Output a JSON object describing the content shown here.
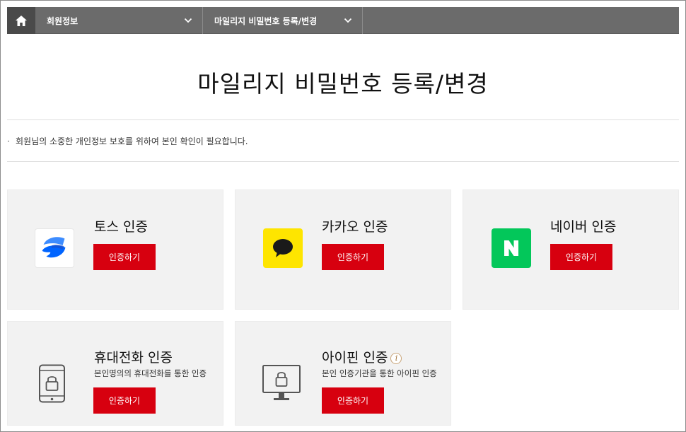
{
  "nav": {
    "home_icon": "home-icon",
    "segments": [
      {
        "label": "회원정보"
      },
      {
        "label": "마일리지 비밀번호 등록/변경"
      }
    ]
  },
  "page": {
    "title": "마일리지 비밀번호 등록/변경",
    "notice": "회원님의 소중한 개인정보 보호를 위하여 본인 확인이 필요합니다.",
    "notice_bullet": "·"
  },
  "colors": {
    "nav_bg": "#6b6b6b",
    "home_bg": "#4a4a4a",
    "card_bg": "#f2f2f2",
    "button_red": "#d7000f",
    "kakao_yellow": "#fee500",
    "naver_green": "#03c75a",
    "toss_blue": "#0064ff"
  },
  "cards": [
    {
      "title": "토스 인증",
      "subtitle": "",
      "button": "인증하기",
      "icon": "toss-logo-icon"
    },
    {
      "title": "카카오 인증",
      "subtitle": "",
      "button": "인증하기",
      "icon": "kakao-logo-icon"
    },
    {
      "title": "네이버 인증",
      "subtitle": "",
      "button": "인증하기",
      "icon": "naver-logo-icon"
    },
    {
      "title": "휴대전화 인증",
      "subtitle": "본인명의의 휴대전화를 통한 인증",
      "button": "인증하기",
      "icon": "phone-lock-icon"
    },
    {
      "title": "아이핀 인증",
      "subtitle": "본인 인증기관을 통한 아이핀 인증",
      "button": "인증하기",
      "icon": "monitor-lock-icon",
      "info_glyph": "i"
    }
  ]
}
